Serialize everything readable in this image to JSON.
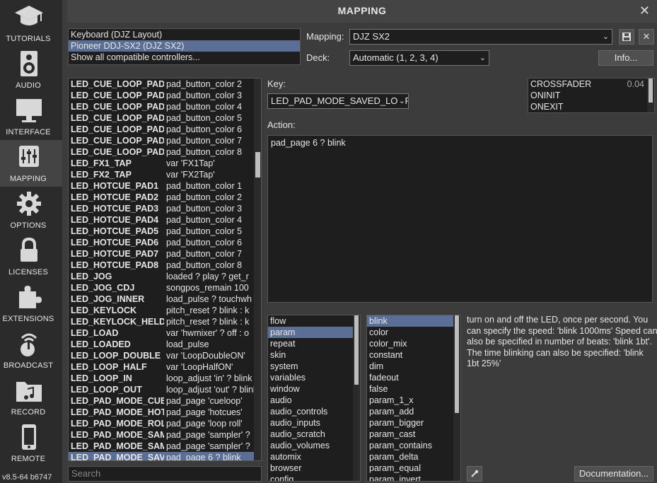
{
  "sidebar": {
    "items": [
      {
        "label": "TUTORIALS",
        "icon": "graduation-cap-icon"
      },
      {
        "label": "AUDIO",
        "icon": "speaker-icon"
      },
      {
        "label": "INTERFACE",
        "icon": "monitor-icon"
      },
      {
        "label": "MAPPING",
        "icon": "sliders-icon",
        "active": true
      },
      {
        "label": "OPTIONS",
        "icon": "gear-icon"
      },
      {
        "label": "LICENSES",
        "icon": "lock-icon"
      },
      {
        "label": "EXTENSIONS",
        "icon": "puzzle-icon"
      },
      {
        "label": "BROADCAST",
        "icon": "broadcast-icon"
      },
      {
        "label": "RECORD",
        "icon": "record-folder-icon"
      },
      {
        "label": "REMOTE",
        "icon": "phone-icon"
      }
    ],
    "version": "v8.5-64 b6747"
  },
  "header": {
    "title": "MAPPING",
    "close": "✕"
  },
  "controllers": {
    "items": [
      {
        "label": "Keyboard (DJZ Layout)"
      },
      {
        "label": "Pioneer DDJ-SX2 (DJZ SX2)",
        "selected": true
      },
      {
        "label": "Show all compatible controllers..."
      }
    ]
  },
  "mapping": {
    "label": "Mapping:",
    "value": "DJZ SX2",
    "deck_label": "Deck:",
    "deck_value": "Automatic (1, 2, 3, 4)",
    "info_button": "Info..."
  },
  "keys": {
    "rows": [
      {
        "name": "LED_CUE_LOOP_PAD",
        "value": "pad_button_color 2"
      },
      {
        "name": "LED_CUE_LOOP_PAD",
        "value": "pad_button_color 3"
      },
      {
        "name": "LED_CUE_LOOP_PAD",
        "value": "pad_button_color 4"
      },
      {
        "name": "LED_CUE_LOOP_PAD",
        "value": "pad_button_color 5"
      },
      {
        "name": "LED_CUE_LOOP_PAD",
        "value": "pad_button_color 6"
      },
      {
        "name": "LED_CUE_LOOP_PAD",
        "value": "pad_button_color 7"
      },
      {
        "name": "LED_CUE_LOOP_PAD",
        "value": "pad_button_color 8"
      },
      {
        "name": "LED_FX1_TAP",
        "value": "var 'FX1Tap'"
      },
      {
        "name": "LED_FX2_TAP",
        "value": "var 'FX2Tap'"
      },
      {
        "name": "LED_HOTCUE_PAD1",
        "value": "pad_button_color 1"
      },
      {
        "name": "LED_HOTCUE_PAD2",
        "value": "pad_button_color 2"
      },
      {
        "name": "LED_HOTCUE_PAD3",
        "value": "pad_button_color 3"
      },
      {
        "name": "LED_HOTCUE_PAD4",
        "value": "pad_button_color 4"
      },
      {
        "name": "LED_HOTCUE_PAD5",
        "value": "pad_button_color 5"
      },
      {
        "name": "LED_HOTCUE_PAD6",
        "value": "pad_button_color 6"
      },
      {
        "name": "LED_HOTCUE_PAD7",
        "value": "pad_button_color 7"
      },
      {
        "name": "LED_HOTCUE_PAD8",
        "value": "pad_button_color 8"
      },
      {
        "name": "LED_JOG",
        "value": "loaded ? play ? get_r"
      },
      {
        "name": "LED_JOG_CDJ",
        "value": "songpos_remain 100"
      },
      {
        "name": "LED_JOG_INNER",
        "value": "load_pulse ? touchwh"
      },
      {
        "name": "LED_KEYLOCK",
        "value": "pitch_reset ? blink : k"
      },
      {
        "name": "LED_KEYLOCK_HELD",
        "value": "pitch_reset ? blink : k"
      },
      {
        "name": "LED_LOAD",
        "value": "var 'hwmixer' ? off : o"
      },
      {
        "name": "LED_LOADED",
        "value": "load_pulse"
      },
      {
        "name": "LED_LOOP_DOUBLE",
        "value": "var 'LoopDoubleON'"
      },
      {
        "name": "LED_LOOP_HALF",
        "value": "var 'LoopHalfON'"
      },
      {
        "name": "LED_LOOP_IN",
        "value": "loop_adjust 'in' ? blink"
      },
      {
        "name": "LED_LOOP_OUT",
        "value": "loop_adjust 'out' ? blink"
      },
      {
        "name": "LED_PAD_MODE_CUELOOP",
        "value": "pad_page 'cueloop'"
      },
      {
        "name": "LED_PAD_MODE_HOTCUE",
        "value": "pad_page 'hotcues'"
      },
      {
        "name": "LED_PAD_MODE_ROLL",
        "value": "pad_page 'loop roll'"
      },
      {
        "name": "LED_PAD_MODE_SAMPLER",
        "value": "pad_page 'sampler' ?"
      },
      {
        "name": "LED_PAD_MODE_SAMPLER",
        "value": "pad_page 'sampler' ?"
      },
      {
        "name": "LED_PAD_MODE_SAVED_LOOP",
        "value": "pad_page 6 ? blink",
        "selected": true
      }
    ],
    "search_placeholder": "Search"
  },
  "editor": {
    "key_label": "Key:",
    "key_value": "LED_PAD_MODE_SAVED_LOOP",
    "action_label": "Action:",
    "action_value": "pad_page 6 ? blink",
    "triggers": [
      {
        "name": "CROSSFADER",
        "value": "0.04"
      },
      {
        "name": "ONINIT",
        "value": ""
      },
      {
        "name": "ONEXIT",
        "value": ""
      }
    ]
  },
  "categories": {
    "items": [
      {
        "label": "flow"
      },
      {
        "label": "param",
        "selected": true
      },
      {
        "label": "repeat"
      },
      {
        "label": "skin"
      },
      {
        "label": "system"
      },
      {
        "label": "variables"
      },
      {
        "label": "window"
      },
      {
        "label": "audio"
      },
      {
        "label": "audio_controls"
      },
      {
        "label": "audio_inputs"
      },
      {
        "label": "audio_scratch"
      },
      {
        "label": "audio_volumes"
      },
      {
        "label": "automix"
      },
      {
        "label": "browser"
      },
      {
        "label": "config"
      }
    ]
  },
  "verbs": {
    "items": [
      {
        "label": "blink",
        "selected": true
      },
      {
        "label": "color"
      },
      {
        "label": "color_mix"
      },
      {
        "label": "constant"
      },
      {
        "label": "dim"
      },
      {
        "label": "fadeout"
      },
      {
        "label": "false"
      },
      {
        "label": "param_1_x"
      },
      {
        "label": "param_add"
      },
      {
        "label": "param_bigger"
      },
      {
        "label": "param_cast"
      },
      {
        "label": "param_contains"
      },
      {
        "label": "param_delta"
      },
      {
        "label": "param_equal"
      },
      {
        "label": "param_invert"
      }
    ]
  },
  "help": {
    "text": "turn on and off the LED, once per second. You can specify the speed: 'blink 1000ms' Speed can also be specified in number of beats: 'blink 1bt'. The time blinking can also be specified: 'blink 1bt 25%'",
    "documentation_button": "Documentation..."
  }
}
